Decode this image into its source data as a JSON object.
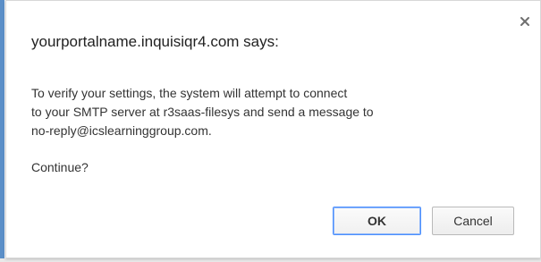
{
  "dialog": {
    "title": "yourportalname.inquisiqr4.com says:",
    "message_lines": [
      "To verify your settings, the system will attempt to connect",
      "to your SMTP server at r3saas-filesys and send a message to",
      "no-reply@icslearninggroup.com."
    ],
    "prompt": "Continue?",
    "close_icon": "close-icon",
    "buttons": {
      "ok": "OK",
      "cancel": "Cancel"
    }
  },
  "colors": {
    "accent_focus": "#4d90fe",
    "window_edge": "#5b8fc8"
  }
}
